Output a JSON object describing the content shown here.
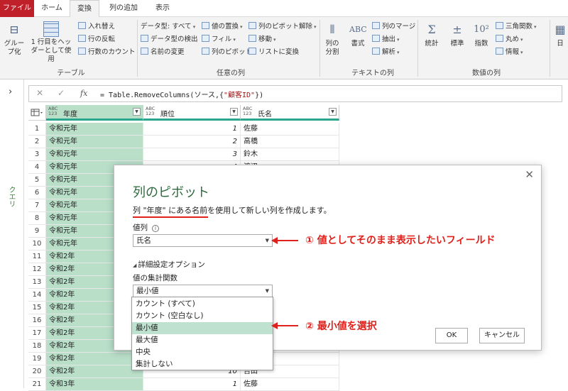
{
  "tabs": [
    "ファイル",
    "ホーム",
    "変換",
    "列の追加",
    "表示"
  ],
  "ribbon": {
    "table_group": {
      "label": "テーブル",
      "group_by": "グループ化",
      "use_first_row": "1 行目をヘッダーとして使用",
      "transpose": "入れ替え",
      "reverse_rows": "行の反転",
      "count_rows": "行数のカウント"
    },
    "any_column_group": {
      "label": "任意の列",
      "data_type": "データ型: すべて",
      "detect_type": "データ型の検出",
      "rename": "名前の変更",
      "replace_values": "値の置換",
      "fill": "フィル",
      "pivot": "列のピボット",
      "unpivot": "列のピボット解除",
      "move": "移動",
      "to_list": "リストに変換"
    },
    "text_column_group": {
      "label": "テキストの列",
      "split": "列の分割",
      "format": "書式",
      "merge": "列のマージ",
      "extract": "抽出",
      "parse": "解析"
    },
    "number_column_group": {
      "label": "数値の列",
      "statistics": "統計",
      "standard": "標準",
      "scientific": "指数",
      "trig": "三角関数",
      "rounding": "丸め",
      "information": "情報"
    },
    "date_partial": "日"
  },
  "sidebar": {
    "queries_label": "クエリ"
  },
  "formula_bar": {
    "prefix": "= Table.RemoveColumns(ソース,{",
    "string": "\"顧客ID\"",
    "suffix": "})"
  },
  "table": {
    "columns": [
      {
        "type": "ABC\n123",
        "name": "年度"
      },
      {
        "type": "ABC\n123",
        "name": "順位"
      },
      {
        "type": "ABC\n123",
        "name": "氏名"
      }
    ],
    "rows": [
      {
        "n": "1",
        "year": "令和元年",
        "rank": "1",
        "name": "佐藤"
      },
      {
        "n": "2",
        "year": "令和元年",
        "rank": "2",
        "name": "高橋"
      },
      {
        "n": "3",
        "year": "令和元年",
        "rank": "3",
        "name": "鈴木"
      },
      {
        "n": "4",
        "year": "令和元年",
        "rank": "4",
        "name": "渡辺"
      },
      {
        "n": "5",
        "year": "令和元年",
        "rank": "",
        "name": ""
      },
      {
        "n": "6",
        "year": "令和元年",
        "rank": "",
        "name": ""
      },
      {
        "n": "7",
        "year": "令和元年",
        "rank": "",
        "name": ""
      },
      {
        "n": "8",
        "year": "令和元年",
        "rank": "",
        "name": ""
      },
      {
        "n": "9",
        "year": "令和元年",
        "rank": "",
        "name": ""
      },
      {
        "n": "10",
        "year": "令和元年",
        "rank": "",
        "name": ""
      },
      {
        "n": "11",
        "year": "令和2年",
        "rank": "",
        "name": ""
      },
      {
        "n": "12",
        "year": "令和2年",
        "rank": "",
        "name": ""
      },
      {
        "n": "13",
        "year": "令和2年",
        "rank": "",
        "name": ""
      },
      {
        "n": "14",
        "year": "令和2年",
        "rank": "",
        "name": ""
      },
      {
        "n": "15",
        "year": "令和2年",
        "rank": "",
        "name": ""
      },
      {
        "n": "16",
        "year": "令和2年",
        "rank": "",
        "name": ""
      },
      {
        "n": "17",
        "year": "令和2年",
        "rank": "",
        "name": ""
      },
      {
        "n": "18",
        "year": "令和2年",
        "rank": "",
        "name": ""
      },
      {
        "n": "19",
        "year": "令和2年",
        "rank": "",
        "name": ""
      },
      {
        "n": "20",
        "year": "令和2年",
        "rank": "10",
        "name": "吉田"
      },
      {
        "n": "21",
        "year": "令和3年",
        "rank": "1",
        "name": "佐藤"
      }
    ]
  },
  "dialog": {
    "title": "列のピボット",
    "description": "列 \"年度\" にある名前を使用して新しい列を作成します。",
    "value_column_label": "値列",
    "value_column_selected": "氏名",
    "advanced_label": "詳細設定オプション",
    "aggregate_label": "値の集計関数",
    "aggregate_selected": "最小値",
    "aggregate_options": [
      "カウント (すべて)",
      "カウント (空白なし)",
      "最小値",
      "最大値",
      "中央",
      "集計しない"
    ],
    "selected_index": 2,
    "ok_label": "OK",
    "cancel_label": "キャンセル"
  },
  "annotations": {
    "note1": "① 値としてそのまま表示したいフィールド",
    "note2": "② 最小値を選択",
    "accent_color": "#e0201a"
  }
}
